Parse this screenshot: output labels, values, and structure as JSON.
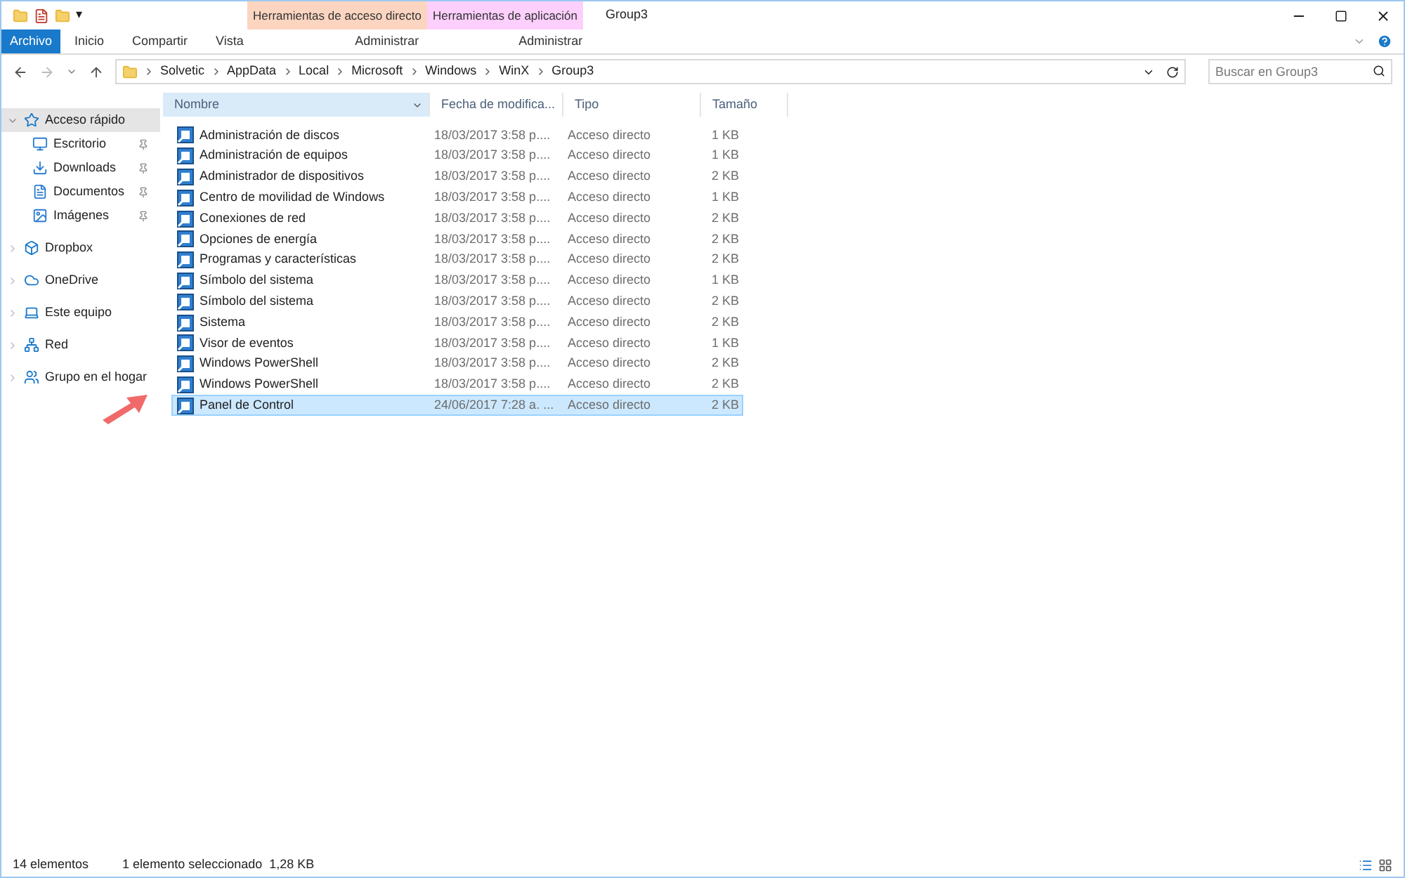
{
  "quick_access_toolbar": {
    "dropdown": "▾"
  },
  "context_tabs": [
    {
      "label": "Herramientas de acceso directo",
      "color": "#fbd5c0",
      "sub": "Administrar"
    },
    {
      "label": "Herramientas de aplicación",
      "color": "#fccffc",
      "sub": "Administrar"
    }
  ],
  "window": {
    "title": "Group3"
  },
  "ribbon_tabs": [
    {
      "label": "Archivo",
      "kind": "file"
    },
    {
      "label": "Inicio",
      "kind": "tab"
    },
    {
      "label": "Compartir",
      "kind": "tab"
    },
    {
      "label": "Vista",
      "kind": "tab"
    }
  ],
  "address_bar": {
    "path": [
      "Solvetic",
      "AppData",
      "Local",
      "Microsoft",
      "Windows",
      "WinX",
      "Group3"
    ]
  },
  "search": {
    "placeholder": "Buscar en Group3"
  },
  "sidebar": {
    "items": [
      {
        "label": "Acceso rápido",
        "selected": true,
        "expanded": true,
        "children": [
          {
            "label": "Escritorio",
            "pinned": true
          },
          {
            "label": "Downloads",
            "pinned": true
          },
          {
            "label": "Documentos",
            "pinned": true
          },
          {
            "label": "Imágenes",
            "pinned": true
          }
        ]
      },
      {
        "label": "Dropbox",
        "selected": false,
        "expanded": false
      },
      {
        "label": "OneDrive",
        "selected": false,
        "expanded": false
      },
      {
        "label": "Este equipo",
        "selected": false,
        "expanded": false
      },
      {
        "label": "Red",
        "selected": false,
        "expanded": false
      },
      {
        "label": "Grupo en el hogar",
        "selected": false,
        "expanded": false
      }
    ]
  },
  "table": {
    "columns": [
      {
        "label": "Nombre",
        "sorted": true
      },
      {
        "label": "Fecha de modifica...",
        "sorted": false
      },
      {
        "label": "Tipo",
        "sorted": false
      },
      {
        "label": "Tamaño",
        "sorted": false
      }
    ],
    "rows": [
      {
        "name": "Administración de discos",
        "date": "18/03/2017 3:58 p....",
        "type": "Acceso directo",
        "size": "1 KB",
        "selected": false
      },
      {
        "name": "Administración de equipos",
        "date": "18/03/2017 3:58 p....",
        "type": "Acceso directo",
        "size": "1 KB",
        "selected": false
      },
      {
        "name": "Administrador de dispositivos",
        "date": "18/03/2017 3:58 p....",
        "type": "Acceso directo",
        "size": "2 KB",
        "selected": false
      },
      {
        "name": "Centro de movilidad de Windows",
        "date": "18/03/2017 3:58 p....",
        "type": "Acceso directo",
        "size": "1 KB",
        "selected": false
      },
      {
        "name": "Conexiones de red",
        "date": "18/03/2017 3:58 p....",
        "type": "Acceso directo",
        "size": "2 KB",
        "selected": false
      },
      {
        "name": "Opciones de energía",
        "date": "18/03/2017 3:58 p....",
        "type": "Acceso directo",
        "size": "2 KB",
        "selected": false
      },
      {
        "name": "Programas y características",
        "date": "18/03/2017 3:58 p....",
        "type": "Acceso directo",
        "size": "2 KB",
        "selected": false
      },
      {
        "name": "Símbolo del sistema",
        "date": "18/03/2017 3:58 p....",
        "type": "Acceso directo",
        "size": "1 KB",
        "selected": false
      },
      {
        "name": "Símbolo del sistema",
        "date": "18/03/2017 3:58 p....",
        "type": "Acceso directo",
        "size": "2 KB",
        "selected": false
      },
      {
        "name": "Sistema",
        "date": "18/03/2017 3:58 p....",
        "type": "Acceso directo",
        "size": "2 KB",
        "selected": false
      },
      {
        "name": "Visor de eventos",
        "date": "18/03/2017 3:58 p....",
        "type": "Acceso directo",
        "size": "1 KB",
        "selected": false
      },
      {
        "name": "Windows PowerShell",
        "date": "18/03/2017 3:58 p....",
        "type": "Acceso directo",
        "size": "2 KB",
        "selected": false
      },
      {
        "name": "Windows PowerShell",
        "date": "18/03/2017 3:58 p....",
        "type": "Acceso directo",
        "size": "2 KB",
        "selected": false
      },
      {
        "name": "Panel de Control",
        "date": "24/06/2017 7:28 a. ...",
        "type": "Acceso directo",
        "size": "2 KB",
        "selected": true
      }
    ]
  },
  "status_bar": {
    "count": "14 elementos",
    "selection": "1 elemento seleccionado  1,28 KB"
  }
}
